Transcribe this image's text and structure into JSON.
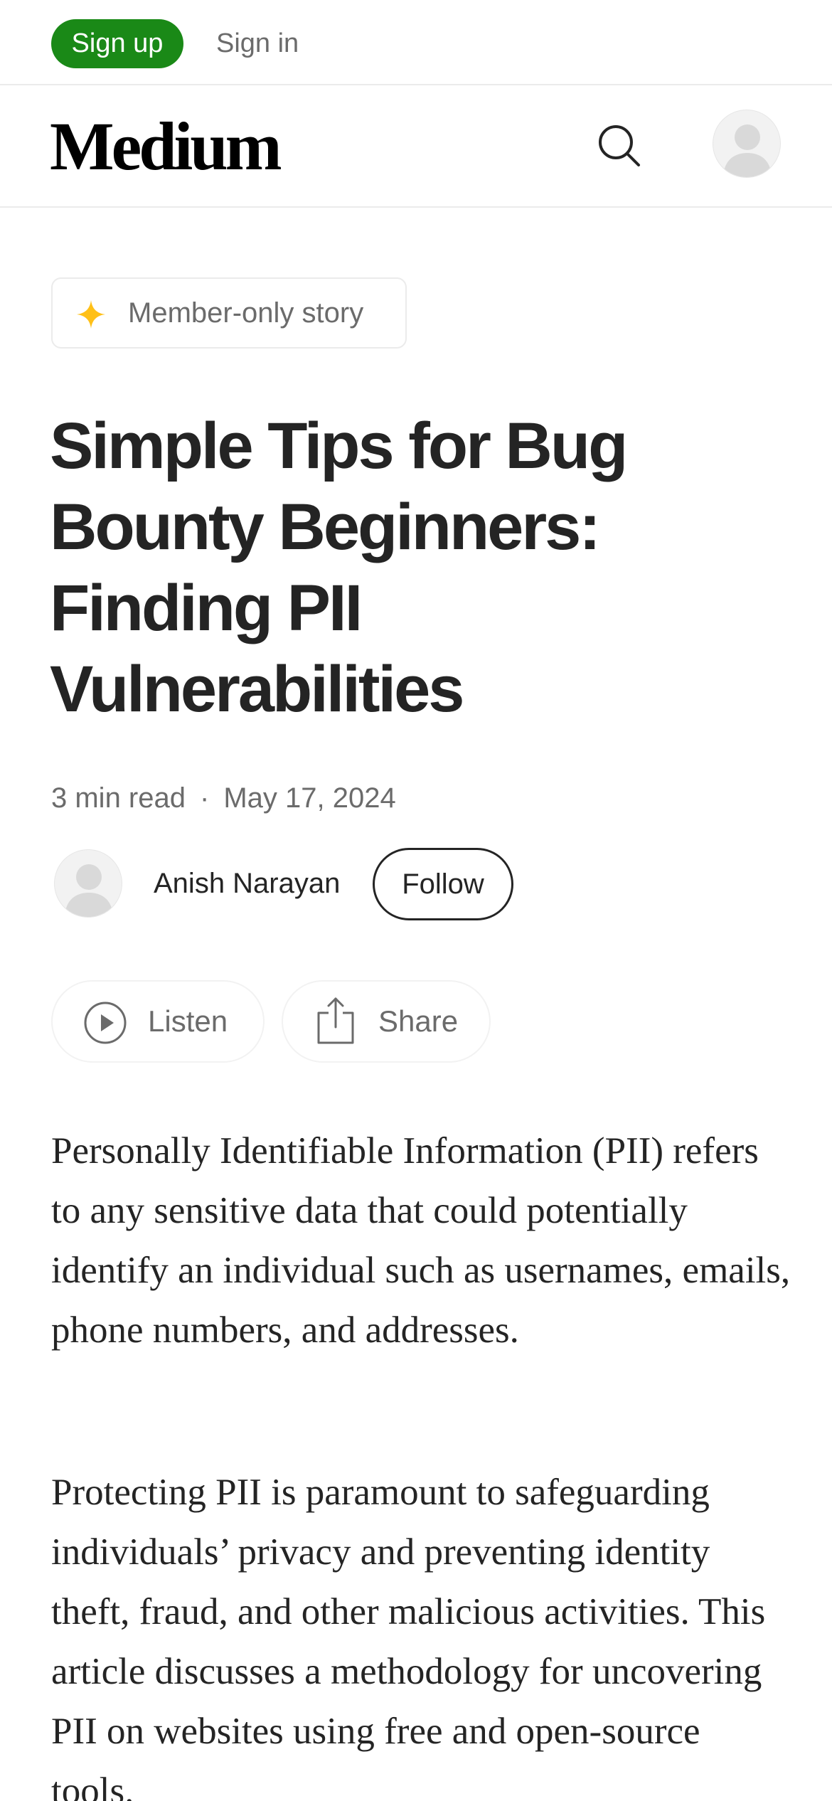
{
  "topbar": {
    "signup_label": "Sign up",
    "signin_label": "Sign in"
  },
  "header": {
    "logo_text": "Medium"
  },
  "article": {
    "member_badge": "Member-only story",
    "title": "Simple Tips for Bug Bounty Beginners: Finding PII Vulnerabilities",
    "read_time": "3 min read",
    "separator": "·",
    "date": "May 17, 2024",
    "author_name": "Anish Narayan",
    "follow_label": "Follow",
    "listen_label": "Listen",
    "share_label": "Share",
    "paragraphs": [
      "Personally Identifiable Information (PII) refers to any sensitive data that could potentially identify an individual such as usernames, emails, phone numbers, and addresses.",
      "Protecting PII is paramount to safeguarding individuals’ privacy and preventing identity theft, fraud, and other malicious activities. This article discusses a methodology for uncovering PII on websites using free and open-source tools."
    ]
  },
  "colors": {
    "brand_green": "#1a8917",
    "member_star": "#ffc017",
    "text_primary": "#242424",
    "text_secondary": "#6b6b6b"
  },
  "icons": {
    "search": "search-icon",
    "avatar": "avatar-icon",
    "star": "star-icon",
    "play": "play-circle-icon",
    "share": "share-icon"
  }
}
